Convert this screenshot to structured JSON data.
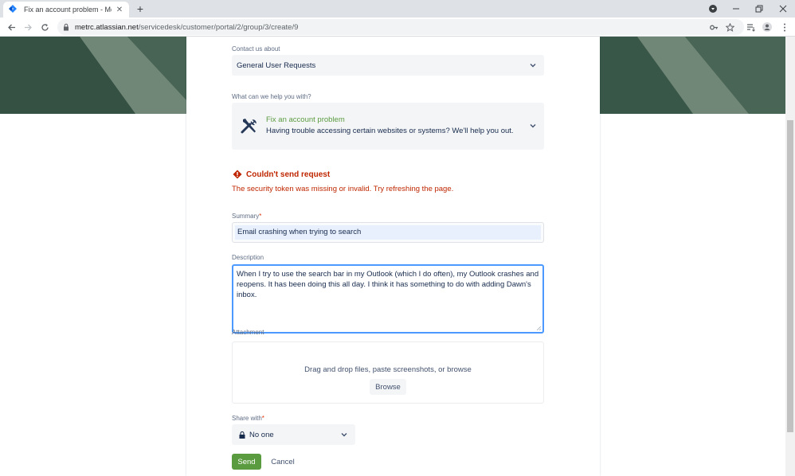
{
  "browser": {
    "tab_title": "Fix an account problem - Metrc I",
    "tab_close": "✕",
    "new_tab": "+",
    "url_host": "metrc.atlassian.net",
    "url_path": "/servicedesk/customer/portal/2/group/3/create/9"
  },
  "form": {
    "contact_label": "Contact us about",
    "contact_value": "General User Requests",
    "help_label": "What can we help you with?",
    "request_type_title": "Fix an account problem",
    "request_type_desc": "Having trouble accessing certain websites or systems? We'll help you out.",
    "error_title": "Couldn't send request",
    "error_message": "The security token was missing or invalid. Try refreshing the page.",
    "summary_label": "Summary",
    "required_mark": "*",
    "summary_value": "Email crashing when trying to search",
    "description_label": "Description",
    "description_value": "When I try to use the search bar in my Outlook (which I do often), my Outlook crashes and reopens. It has been doing this all day. I think it has something to do with adding Dawn's inbox.",
    "attachment_label": "Attachment",
    "attachment_hint": "Drag and drop files, paste screenshots, or browse",
    "browse_label": "Browse",
    "share_label": "Share with",
    "share_value": "No one",
    "send_label": "Send",
    "cancel_label": "Cancel"
  },
  "colors": {
    "brand_green": "#5b9b3f",
    "error_red": "#bf2600",
    "focus_blue": "#4c9aff",
    "banner": "#2e4a3c"
  }
}
